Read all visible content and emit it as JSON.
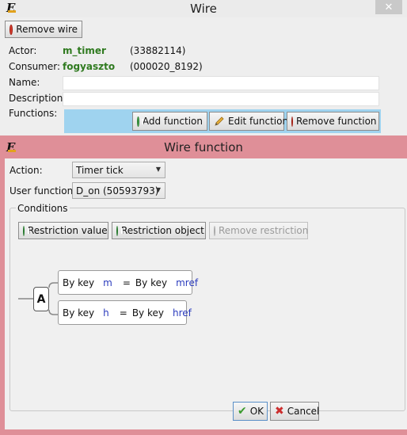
{
  "wire_window": {
    "title": "Wire",
    "close_glyph": "✕",
    "remove_wire": "Remove wire",
    "actor_label": "Actor:",
    "actor_value": "m_timer",
    "actor_id": "(33882114)",
    "consumer_label": "Consumer:",
    "consumer_value": "fogyaszto",
    "consumer_id": "(000020_8192)",
    "name_label": "Name:",
    "description_label": "Description:",
    "functions_label": "Functions:",
    "add_function": "Add function",
    "edit_function": "Edit function",
    "remove_function": "Remove function"
  },
  "function_window": {
    "title": "Wire function",
    "action_label": "Action:",
    "action_value": "Timer tick",
    "user_function_label": "User function:",
    "user_function_value": "D_on (50593793)",
    "conditions_legend": "Conditions",
    "restriction_value": "Restriction value",
    "restriction_object": "Restriction object",
    "remove_restriction": "Remove restriction",
    "operator": "A",
    "conditions": [
      {
        "by_key_1": "By key",
        "key": "m",
        "eq": "=",
        "by_key_2": "By key",
        "ref": "mref"
      },
      {
        "by_key_1": "By key",
        "key": "h",
        "eq": "=",
        "by_key_2": "By key",
        "ref": "href"
      }
    ],
    "ok": "OK",
    "cancel": "Cancel"
  },
  "colors": {
    "function_frame": "#df8f98",
    "functions_list_bg": "#9fd3ef",
    "value_green": "#2f7a1f",
    "key_blue": "#2a3bbd",
    "close_button": "#c9c9c9"
  },
  "icons": [
    "app-logo-icon",
    "remove-icon",
    "add-icon",
    "edit-pencil-icon",
    "ok-check-icon",
    "cancel-x-icon",
    "chevron-down-icon"
  ]
}
